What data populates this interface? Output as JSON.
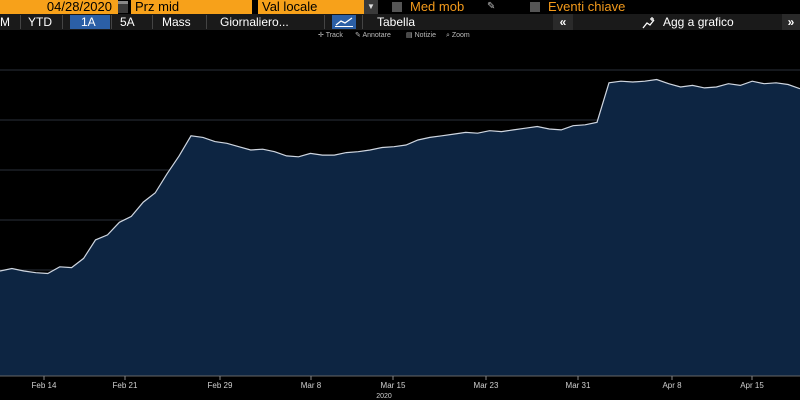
{
  "toolbar": {
    "date_value": "04/28/2020",
    "price_select": "Prz mid",
    "currency_select": "Val locale",
    "moving_avg_label": "Med mob",
    "key_events_label": "Eventi chiave"
  },
  "toolbar2": {
    "periods": [
      "M",
      "YTD",
      "1A",
      "5A",
      "Mass"
    ],
    "active_period": "1A",
    "frequency_select": "Giornaliero...",
    "table_label": "Tabella",
    "add_to_chart_label": "Agg a grafico"
  },
  "mini_menu": {
    "items": [
      "Track",
      "Annotare",
      "Notizie",
      "Zoom"
    ]
  },
  "colors": {
    "accent_orange": "#f7a11a",
    "active_blue": "#2b5fa6",
    "area_fill": "#0d2542",
    "line": "#cfd6e0"
  },
  "chart_data": {
    "type": "area",
    "x_tick_labels": [
      "Feb 14",
      "Feb 21",
      "Feb 29",
      "Mar 8",
      "Mar 15",
      "Mar 23",
      "Mar 31",
      "Apr 8",
      "Apr 15"
    ],
    "x_year_label": "2020",
    "grid": true,
    "series": [
      {
        "values": [
          45.0,
          45.6,
          45.0,
          44.6,
          44.4,
          46.0,
          45.8,
          48.0,
          52.4,
          53.6,
          56.6,
          58.0,
          61.4,
          63.6,
          68.2,
          72.4,
          77.2,
          76.8,
          75.8,
          75.4,
          74.6,
          73.8,
          74.0,
          73.4,
          72.4,
          72.2,
          73.0,
          72.6,
          72.6,
          73.2,
          73.4,
          73.8,
          74.4,
          74.6,
          75.0,
          76.2,
          76.8,
          77.2,
          77.6,
          78.0,
          77.8,
          78.4,
          78.2,
          78.6,
          79.0,
          79.4,
          78.8,
          78.6,
          79.6,
          79.8,
          80.4,
          89.8,
          90.2,
          90.0,
          90.2,
          90.6,
          89.6,
          88.8,
          89.2,
          88.6,
          88.8,
          89.6,
          89.2,
          90.2,
          89.6,
          89.8,
          89.4,
          88.4
        ]
      }
    ]
  }
}
